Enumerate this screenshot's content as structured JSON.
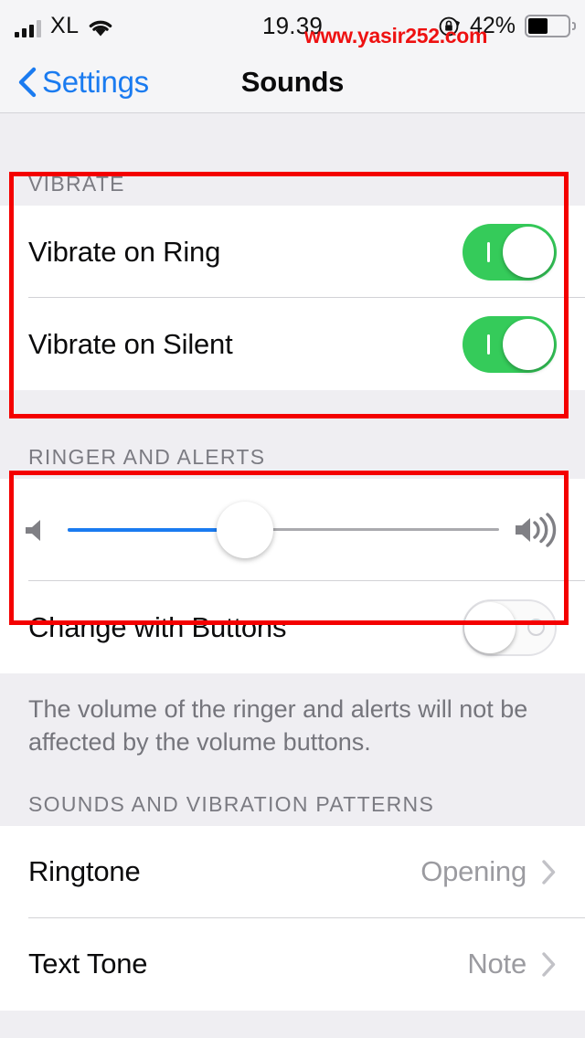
{
  "status_bar": {
    "carrier": "XL",
    "signal_icon": "cellular-bars-icon",
    "wifi_icon": "wifi-icon",
    "time": "19.39",
    "rotation_lock_icon": "rotation-lock-icon",
    "battery_percent": "42%",
    "battery_level": 42,
    "battery_icon": "battery-icon"
  },
  "watermark": {
    "text": "www.yasir252.com",
    "color": "#ee1111"
  },
  "nav": {
    "back_label": "Settings",
    "back_icon": "chevron-left-icon",
    "title": "Sounds"
  },
  "sections": {
    "vibrate": {
      "header": "VIBRATE",
      "rows": [
        {
          "label": "Vibrate on Ring",
          "toggle": "on"
        },
        {
          "label": "Vibrate on Silent",
          "toggle": "on"
        }
      ]
    },
    "ringer": {
      "header": "RINGER AND ALERTS",
      "slider": {
        "value": 41,
        "min_icon": "speaker-low-icon",
        "max_icon": "speaker-high-icon",
        "fill_color": "#1a7bf0"
      },
      "change_with_buttons": {
        "label": "Change with Buttons",
        "toggle": "off"
      },
      "footer_note": "The volume of the ringer and alerts will not be affected by the volume buttons."
    },
    "patterns": {
      "header": "SOUNDS AND VIBRATION PATTERNS",
      "rows": [
        {
          "label": "Ringtone",
          "value": "Opening",
          "chevron": "chevron-right-icon"
        },
        {
          "label": "Text Tone",
          "value": "Note",
          "chevron": "chevron-right-icon"
        }
      ]
    }
  },
  "annotations": {
    "color": "#f40000",
    "boxes": [
      {
        "name": "vibrate-section-highlight"
      },
      {
        "name": "ringer-slider-highlight"
      }
    ]
  }
}
